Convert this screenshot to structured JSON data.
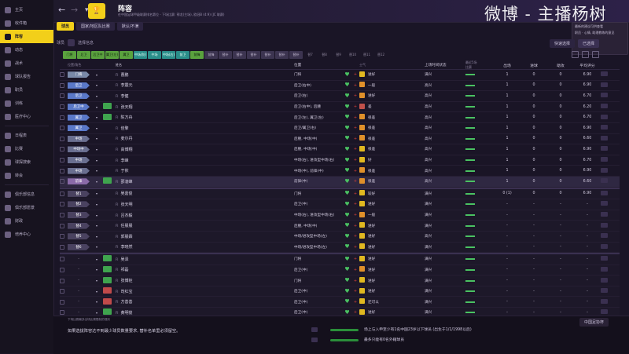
{
  "sidebar": {
    "items": [
      {
        "label": "主页",
        "active": false
      },
      {
        "label": "收件箱",
        "active": false
      },
      {
        "label": "阵容",
        "active": true
      },
      {
        "label": "动态",
        "active": false
      },
      {
        "label": "战术",
        "active": false
      },
      {
        "label": "球队报告",
        "active": false
      },
      {
        "label": "职员",
        "active": false
      },
      {
        "label": "训练",
        "active": false
      },
      {
        "label": "医疗中心",
        "active": false
      },
      {
        "label": "日程表",
        "active": false
      },
      {
        "label": "比赛",
        "active": false
      },
      {
        "label": "球探搜索",
        "active": false
      },
      {
        "label": "转会",
        "active": false
      },
      {
        "label": "俱乐部信息",
        "active": false
      },
      {
        "label": "俱乐部愿景",
        "active": false
      },
      {
        "label": "财政",
        "active": false
      },
      {
        "label": "培养中心",
        "active": false
      }
    ]
  },
  "header": {
    "title": "阵容",
    "subtitle": "在中国足球甲级联赛排名第位 - 下场比赛: 鄂龙(主场), 欧冠B (4:9) (JC 联赛)",
    "badge": "🏆",
    "watermark": "微博 - 主播杨树"
  },
  "notification": {
    "line1": "最新的建议可供查看",
    "line2": "职员 · 心情, 助理教练的意见"
  },
  "tabs": {
    "primary": "球员",
    "secondary": "国家/地区队比赛",
    "tertiary": "默认/不满"
  },
  "filter": {
    "label": "球员",
    "chip": "选择信息"
  },
  "quick_buttons": {
    "quick_select": "快速选择",
    "selected": "已选择"
  },
  "position_filters": [
    {
      "label": "门将",
      "style": "green"
    },
    {
      "label": "后卫",
      "style": "green"
    },
    {
      "label": "后卫中",
      "style": "green"
    },
    {
      "label": "翼卫(左)",
      "style": "green"
    },
    {
      "label": "翼卫",
      "style": "green"
    },
    {
      "label": "中场(防)",
      "style": "teal"
    },
    {
      "label": "中场",
      "style": "teal"
    },
    {
      "label": "中场(右)",
      "style": "teal"
    },
    {
      "label": "前卫",
      "style": "teal"
    },
    {
      "label": "前锋",
      "style": "green"
    },
    {
      "label": "前锋",
      "style": "gray"
    },
    {
      "label": "替补",
      "style": "gray"
    },
    {
      "label": "替补",
      "style": "gray"
    },
    {
      "label": "替补",
      "style": "gray"
    },
    {
      "label": "替补",
      "style": "gray"
    },
    {
      "label": "替补",
      "style": "gray"
    },
    {
      "label": "替补",
      "style": "gray"
    },
    {
      "label": "替7",
      "style": "dim"
    },
    {
      "label": "替8",
      "style": "dim"
    },
    {
      "label": "替9",
      "style": "dim"
    },
    {
      "label": "替10",
      "style": "dim"
    },
    {
      "label": "替11",
      "style": "dim"
    },
    {
      "label": "替12",
      "style": "dim"
    }
  ],
  "columns": {
    "pos": "位置/角色",
    "name": "姓名",
    "position": "位置",
    "moral": "士气",
    "status": "上场时间状态",
    "rating": "最近5场比赛",
    "apps": "出场",
    "goals": "进球",
    "assists": "助攻",
    "avg": "平均评分"
  },
  "players": [
    {
      "slot": "门将",
      "slot_type": "gk",
      "name": "曹鹏",
      "position": "门将",
      "moral_level": "g",
      "moral": "进好",
      "status": "满兴",
      "apps": "1",
      "goals": "0",
      "assists": "0",
      "avg": "6.90"
    },
    {
      "slot": "后卫",
      "slot_type": "def",
      "name": "李震元",
      "position": "后卫(右中)",
      "moral_level": "o",
      "moral": "一般",
      "status": "高兴",
      "apps": "1",
      "goals": "0",
      "assists": "0",
      "avg": "6.90"
    },
    {
      "slot": "后卫",
      "slot_type": "def",
      "name": "李健",
      "position": "后卫(右)",
      "moral_level": "o",
      "moral": "进好",
      "status": "高兴",
      "apps": "1",
      "goals": "0",
      "assists": "0",
      "avg": "6.70"
    },
    {
      "slot": "后卫中",
      "slot_type": "def",
      "tag": "green",
      "name": "张天翔",
      "position": "后卫(右中), 后腰",
      "moral_level": "r",
      "moral": "差",
      "status": "高兴",
      "apps": "1",
      "goals": "0",
      "assists": "0",
      "avg": "6.20"
    },
    {
      "slot": "翼卫",
      "slot_type": "def",
      "tag": "green",
      "name": "陈方舟",
      "position": "后卫(左), 翼卫(左)",
      "moral_level": "o",
      "moral": "很差",
      "status": "高兴",
      "apps": "1",
      "goals": "0",
      "assists": "0",
      "avg": "6.70"
    },
    {
      "slot": "翼卫",
      "slot_type": "def",
      "name": "佳擎",
      "position": "后卫/翼卫(右)",
      "moral_level": "o",
      "moral": "很差",
      "status": "高兴",
      "apps": "1",
      "goals": "0",
      "assists": "0",
      "avg": "6.90"
    },
    {
      "slot": "中场",
      "slot_type": "mid",
      "name": "麦尔丹",
      "position": "后腰, 中场(中)",
      "moral_level": "o",
      "moral": "很差",
      "status": "高兴",
      "apps": "1",
      "goals": "0",
      "assists": "0",
      "avg": "6.60"
    },
    {
      "slot": "中场中",
      "slot_type": "mid",
      "name": "高博翔",
      "position": "后腰, 中场(中)",
      "moral_level": "g",
      "moral": "很差",
      "status": "高兴",
      "apps": "1",
      "goals": "0",
      "assists": "0",
      "avg": "6.90"
    },
    {
      "slot": "中场",
      "slot_type": "mid",
      "name": "李峰",
      "position": "中场(右), 进攻型中场(右)",
      "moral_level": "g",
      "moral": "好",
      "status": "高兴",
      "apps": "1",
      "goals": "0",
      "assists": "0",
      "avg": "6.70"
    },
    {
      "slot": "中场",
      "slot_type": "mid",
      "name": "于依",
      "position": "中场(中), 前锋(中)",
      "moral_level": "o",
      "moral": "很差",
      "status": "高兴",
      "apps": "1",
      "goals": "0",
      "assists": "0",
      "avg": "6.90"
    },
    {
      "slot": "前锋",
      "slot_type": "fwd",
      "tag": "green",
      "name": "邵凌峰",
      "position": "前锋(中)",
      "moral_level": "o",
      "moral": "很差",
      "status": "高兴",
      "apps": "1",
      "goals": "0",
      "assists": "0",
      "avg": "6.60",
      "highlight": true
    },
    {
      "slot": "替1",
      "slot_type": "sub",
      "name": "吴嘉俊",
      "position": "门将",
      "moral_level": "g",
      "moral": "较好",
      "status": "满兴",
      "apps": "0 (1)",
      "goals": "0",
      "assists": "0",
      "avg": "6.90",
      "separator": true
    },
    {
      "slot": "替2",
      "slot_type": "sub",
      "name": "张天明",
      "position": "后卫(中)",
      "moral_level": "g",
      "moral": "进好",
      "status": "满兴",
      "apps": "-",
      "goals": "-",
      "assists": "-",
      "avg": "-"
    },
    {
      "slot": "替3",
      "slot_type": "sub",
      "name": "吕杰毅",
      "position": "中场(右), 进攻型中场(右)",
      "moral_level": "o",
      "moral": "一般",
      "status": "满兴",
      "apps": "-",
      "goals": "-",
      "assists": "-",
      "avg": "-"
    },
    {
      "slot": "替4",
      "slot_type": "sub",
      "name": "任晨晨",
      "position": "后腰, 中场(中)",
      "moral_level": "g",
      "moral": "进好",
      "status": "满兴",
      "apps": "-",
      "goals": "-",
      "assists": "-",
      "avg": "-"
    },
    {
      "slot": "替5",
      "slot_type": "sub",
      "name": "郭晨霖",
      "position": "中场/进攻型中场(左)",
      "moral_level": "g",
      "moral": "进好",
      "status": "高兴",
      "apps": "-",
      "goals": "-",
      "assists": "-",
      "avg": "-"
    },
    {
      "slot": "替6",
      "slot_type": "sub",
      "name": "李晓然",
      "position": "中场/进攻型中场(左)",
      "moral_level": "g",
      "moral": "进好",
      "status": "满兴",
      "apps": "-",
      "goals": "-",
      "assists": "-",
      "avg": "-"
    },
    {
      "slot": "-",
      "slot_type": "res",
      "tag": "green",
      "name": "吴泽",
      "position": "门将",
      "moral_level": "g",
      "moral": "进好",
      "status": "满兴",
      "apps": "-",
      "goals": "-",
      "assists": "-",
      "avg": "-",
      "separator": true
    },
    {
      "slot": "-",
      "slot_type": "res",
      "tag": "green",
      "name": "祁磊",
      "position": "后卫(中)",
      "moral_level": "o",
      "moral": "进好",
      "status": "满兴",
      "apps": "-",
      "goals": "-",
      "assists": "-",
      "avg": "-"
    },
    {
      "slot": "-",
      "slot_type": "res",
      "tag": "green",
      "name": "张博铨",
      "position": "门将",
      "moral_level": "g",
      "moral": "进好",
      "status": "满兴",
      "apps": "-",
      "goals": "-",
      "assists": "-",
      "avg": "-"
    },
    {
      "slot": "-",
      "slot_type": "res",
      "tag": "red",
      "name": "司红宝",
      "position": "后卫(中)",
      "moral_level": "g",
      "moral": "进好",
      "status": "满兴",
      "apps": "-",
      "goals": "-",
      "assists": "-",
      "avg": "-"
    },
    {
      "slot": "-",
      "slot_type": "res",
      "tag": "red",
      "name": "方善善",
      "position": "后卫(中)",
      "moral_level": "g",
      "moral": "还可以",
      "status": "满兴",
      "apps": "-",
      "goals": "-",
      "assists": "-",
      "avg": "-"
    },
    {
      "slot": "-",
      "slot_type": "res",
      "tag": "green",
      "name": "黄明俊",
      "position": "后卫(中)",
      "moral_level": "g",
      "moral": "进好",
      "status": "满兴",
      "apps": "-",
      "goals": "-",
      "assists": "-",
      "avg": "-"
    },
    {
      "slot": "-",
      "slot_type": "res",
      "tag": "green",
      "name": "韦明鑫",
      "position": "中场(中)",
      "moral_level": "g",
      "moral": "进好",
      "status": "满兴",
      "apps": "-",
      "goals": "-",
      "assists": "-",
      "avg": "-"
    }
  ],
  "footer": {
    "note": "下场比赛最多出场比赛限制的规则",
    "main": "如果选拔阵容达不到最少球员数量要求, 替补名单里必须留空。",
    "lang": "中国足协杯",
    "req1": "场上与入申至少有1名中国23岁以下球员 (出生于1/1/1998以后)",
    "req2": "最多只能有0名外籍球员"
  }
}
